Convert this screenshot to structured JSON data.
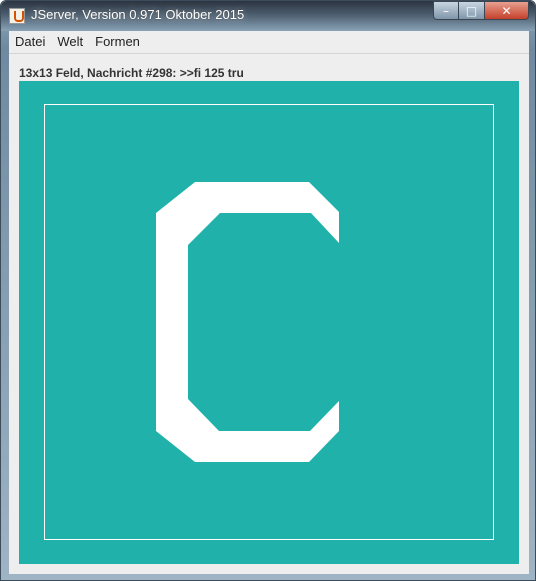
{
  "window": {
    "title": "JServer, Version 0.971 Oktober 2015",
    "icon": "java-icon",
    "controls": [
      "minimize-icon",
      "maximize-icon",
      "close-icon"
    ]
  },
  "menu": {
    "items": [
      "Datei",
      "Welt",
      "Formen"
    ]
  },
  "status": {
    "text": "13x13 Feld, Nachricht #298: >>fi 125 tru"
  },
  "board": {
    "background_color": "#20b2aa",
    "symbol_color": "#ffffff",
    "frame_color": "#ffffff",
    "symbol": "C"
  }
}
